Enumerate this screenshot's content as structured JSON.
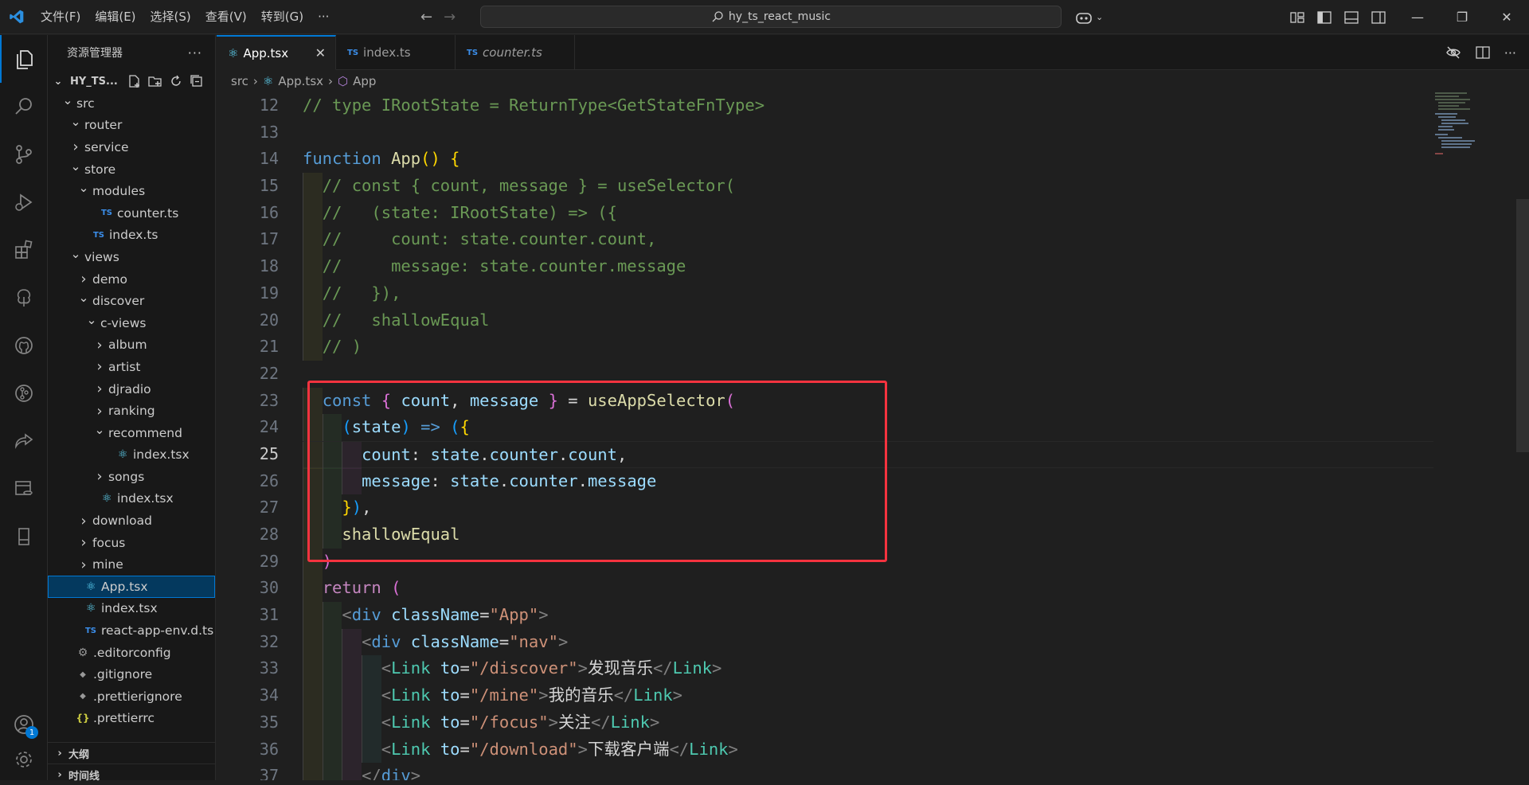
{
  "menu": [
    "文件(F)",
    "编辑(E)",
    "选择(S)",
    "查看(V)",
    "转到(G)",
    "···"
  ],
  "search": {
    "text": "hy_ts_react_music"
  },
  "sidebar": {
    "title": "资源管理器",
    "project": "HY_TS...",
    "tree": [
      {
        "label": "src",
        "indent": 1,
        "kind": "folder-open"
      },
      {
        "label": "router",
        "indent": 2,
        "kind": "folder-open"
      },
      {
        "label": "service",
        "indent": 2,
        "kind": "folder"
      },
      {
        "label": "store",
        "indent": 2,
        "kind": "folder-open"
      },
      {
        "label": "modules",
        "indent": 3,
        "kind": "folder-open"
      },
      {
        "label": "counter.ts",
        "indent": 4,
        "kind": "ts"
      },
      {
        "label": "index.ts",
        "indent": 3,
        "kind": "ts"
      },
      {
        "label": "views",
        "indent": 2,
        "kind": "folder-open"
      },
      {
        "label": "demo",
        "indent": 3,
        "kind": "folder"
      },
      {
        "label": "discover",
        "indent": 3,
        "kind": "folder-open"
      },
      {
        "label": "c-views",
        "indent": 4,
        "kind": "folder-open"
      },
      {
        "label": "album",
        "indent": 5,
        "kind": "folder"
      },
      {
        "label": "artist",
        "indent": 5,
        "kind": "folder"
      },
      {
        "label": "djradio",
        "indent": 5,
        "kind": "folder"
      },
      {
        "label": "ranking",
        "indent": 5,
        "kind": "folder"
      },
      {
        "label": "recommend",
        "indent": 5,
        "kind": "folder-open"
      },
      {
        "label": "index.tsx",
        "indent": 6,
        "kind": "react"
      },
      {
        "label": "songs",
        "indent": 5,
        "kind": "folder"
      },
      {
        "label": "index.tsx",
        "indent": 4,
        "kind": "react"
      },
      {
        "label": "download",
        "indent": 3,
        "kind": "folder"
      },
      {
        "label": "focus",
        "indent": 3,
        "kind": "folder"
      },
      {
        "label": "mine",
        "indent": 3,
        "kind": "folder"
      },
      {
        "label": "App.tsx",
        "indent": 2,
        "kind": "react",
        "selected": true
      },
      {
        "label": "index.tsx",
        "indent": 2,
        "kind": "react"
      },
      {
        "label": "react-app-env.d.ts",
        "indent": 2,
        "kind": "ts"
      },
      {
        "label": ".editorconfig",
        "indent": 1,
        "kind": "cfg"
      },
      {
        "label": ".gitignore",
        "indent": 1,
        "kind": "git"
      },
      {
        "label": ".prettierignore",
        "indent": 1,
        "kind": "git"
      },
      {
        "label": ".prettierrc",
        "indent": 1,
        "kind": "json"
      }
    ],
    "sections": [
      "大纲",
      "时间线"
    ]
  },
  "tabs": [
    {
      "label": "App.tsx",
      "active": true,
      "kind": "react"
    },
    {
      "label": "index.ts",
      "active": false,
      "kind": "ts"
    },
    {
      "label": "counter.ts",
      "active": false,
      "kind": "ts",
      "italic": true
    }
  ],
  "breadcrumb": [
    "src",
    "App.tsx",
    "App"
  ],
  "editor": {
    "current_line": 25,
    "lines": [
      {
        "n": 12,
        "tokens": [
          [
            "c",
            "// type IRootState = ReturnType<GetStateFnType>"
          ]
        ]
      },
      {
        "n": 13,
        "tokens": []
      },
      {
        "n": 14,
        "tokens": [
          [
            "kw",
            "function "
          ],
          [
            "fn",
            "App"
          ],
          [
            "br1",
            "()"
          ],
          [
            "",
            " "
          ],
          [
            "br1",
            "{"
          ]
        ]
      },
      {
        "n": 15,
        "tokens": [
          [
            "",
            "  "
          ],
          [
            "c",
            "// const { count, message } = useSelector("
          ]
        ]
      },
      {
        "n": 16,
        "tokens": [
          [
            "",
            "  "
          ],
          [
            "c",
            "//   (state: IRootState) => ({"
          ]
        ]
      },
      {
        "n": 17,
        "tokens": [
          [
            "",
            "  "
          ],
          [
            "c",
            "//     count: state.counter.count,"
          ]
        ]
      },
      {
        "n": 18,
        "tokens": [
          [
            "",
            "  "
          ],
          [
            "c",
            "//     message: state.counter.message"
          ]
        ]
      },
      {
        "n": 19,
        "tokens": [
          [
            "",
            "  "
          ],
          [
            "c",
            "//   }),"
          ]
        ]
      },
      {
        "n": 20,
        "tokens": [
          [
            "",
            "  "
          ],
          [
            "c",
            "//   shallowEqual"
          ]
        ]
      },
      {
        "n": 21,
        "tokens": [
          [
            "",
            "  "
          ],
          [
            "c",
            "// )"
          ]
        ]
      },
      {
        "n": 22,
        "tokens": []
      },
      {
        "n": 23,
        "tokens": [
          [
            "",
            "  "
          ],
          [
            "kw",
            "const "
          ],
          [
            "br2",
            "{ "
          ],
          [
            "var",
            "count"
          ],
          [
            "",
            ", "
          ],
          [
            "var",
            "message"
          ],
          [
            "br2",
            " }"
          ],
          [
            "",
            " = "
          ],
          [
            "fn",
            "useAppSelector"
          ],
          [
            "br2",
            "("
          ]
        ]
      },
      {
        "n": 24,
        "tokens": [
          [
            "",
            "    "
          ],
          [
            "br3",
            "("
          ],
          [
            "var",
            "state"
          ],
          [
            "br3",
            ")"
          ],
          [
            "kw",
            " => "
          ],
          [
            "br3",
            "("
          ],
          [
            "br1",
            "{"
          ]
        ]
      },
      {
        "n": 25,
        "tokens": [
          [
            "",
            "      "
          ],
          [
            "pr",
            "count"
          ],
          [
            "",
            ": "
          ],
          [
            "var",
            "state"
          ],
          [
            "",
            "."
          ],
          [
            "var",
            "counter"
          ],
          [
            "",
            "."
          ],
          [
            "var",
            "count"
          ],
          [
            "",
            ","
          ]
        ]
      },
      {
        "n": 26,
        "tokens": [
          [
            "",
            "      "
          ],
          [
            "pr",
            "message"
          ],
          [
            "",
            ": "
          ],
          [
            "var",
            "state"
          ],
          [
            "",
            "."
          ],
          [
            "var",
            "counter"
          ],
          [
            "",
            "."
          ],
          [
            "var",
            "message"
          ]
        ]
      },
      {
        "n": 27,
        "tokens": [
          [
            "",
            "    "
          ],
          [
            "br1",
            "}"
          ],
          [
            "br3",
            ")"
          ],
          [
            "",
            ","
          ]
        ]
      },
      {
        "n": 28,
        "tokens": [
          [
            "",
            "    "
          ],
          [
            "fn",
            "shallowEqual"
          ]
        ]
      },
      {
        "n": 29,
        "tokens": [
          [
            "",
            "  "
          ],
          [
            "br2",
            ")"
          ]
        ]
      },
      {
        "n": 30,
        "tokens": [
          [
            "",
            "  "
          ],
          [
            "ctl",
            "return "
          ],
          [
            "br2",
            "("
          ]
        ]
      },
      {
        "n": 31,
        "tokens": [
          [
            "",
            "    "
          ],
          [
            "punc",
            "<"
          ],
          [
            "kw",
            "div"
          ],
          [
            "",
            " "
          ],
          [
            "attr",
            "className"
          ],
          [
            "",
            "="
          ],
          [
            "str",
            "\"App\""
          ],
          [
            "punc",
            ">"
          ]
        ]
      },
      {
        "n": 32,
        "tokens": [
          [
            "",
            "      "
          ],
          [
            "punc",
            "<"
          ],
          [
            "kw",
            "div"
          ],
          [
            "",
            " "
          ],
          [
            "attr",
            "className"
          ],
          [
            "",
            "="
          ],
          [
            "str",
            "\"nav\""
          ],
          [
            "punc",
            ">"
          ]
        ]
      },
      {
        "n": 33,
        "tokens": [
          [
            "",
            "        "
          ],
          [
            "punc",
            "<"
          ],
          [
            "tag",
            "Link"
          ],
          [
            "",
            " "
          ],
          [
            "attr",
            "to"
          ],
          [
            "",
            "="
          ],
          [
            "str",
            "\"/discover\""
          ],
          [
            "punc",
            ">"
          ],
          [
            "",
            "发现音乐"
          ],
          [
            "punc",
            "</"
          ],
          [
            "tag",
            "Link"
          ],
          [
            "punc",
            ">"
          ]
        ]
      },
      {
        "n": 34,
        "tokens": [
          [
            "",
            "        "
          ],
          [
            "punc",
            "<"
          ],
          [
            "tag",
            "Link"
          ],
          [
            "",
            " "
          ],
          [
            "attr",
            "to"
          ],
          [
            "",
            "="
          ],
          [
            "str",
            "\"/mine\""
          ],
          [
            "punc",
            ">"
          ],
          [
            "",
            "我的音乐"
          ],
          [
            "punc",
            "</"
          ],
          [
            "tag",
            "Link"
          ],
          [
            "punc",
            ">"
          ]
        ]
      },
      {
        "n": 35,
        "tokens": [
          [
            "",
            "        "
          ],
          [
            "punc",
            "<"
          ],
          [
            "tag",
            "Link"
          ],
          [
            "",
            " "
          ],
          [
            "attr",
            "to"
          ],
          [
            "",
            "="
          ],
          [
            "str",
            "\"/focus\""
          ],
          [
            "punc",
            ">"
          ],
          [
            "",
            "关注"
          ],
          [
            "punc",
            "</"
          ],
          [
            "tag",
            "Link"
          ],
          [
            "punc",
            ">"
          ]
        ]
      },
      {
        "n": 36,
        "tokens": [
          [
            "",
            "        "
          ],
          [
            "punc",
            "<"
          ],
          [
            "tag",
            "Link"
          ],
          [
            "",
            " "
          ],
          [
            "attr",
            "to"
          ],
          [
            "",
            "="
          ],
          [
            "str",
            "\"/download\""
          ],
          [
            "punc",
            ">"
          ],
          [
            "",
            "下载客户端"
          ],
          [
            "punc",
            "</"
          ],
          [
            "tag",
            "Link"
          ],
          [
            "punc",
            ">"
          ]
        ]
      },
      {
        "n": 37,
        "tokens": [
          [
            "",
            "      "
          ],
          [
            "punc",
            "</"
          ],
          [
            "kw",
            "div"
          ],
          [
            "punc",
            ">"
          ]
        ]
      }
    ]
  },
  "accounts_badge": "1",
  "colors": {
    "accent": "#0078d4",
    "highlight": "#f5333f"
  }
}
